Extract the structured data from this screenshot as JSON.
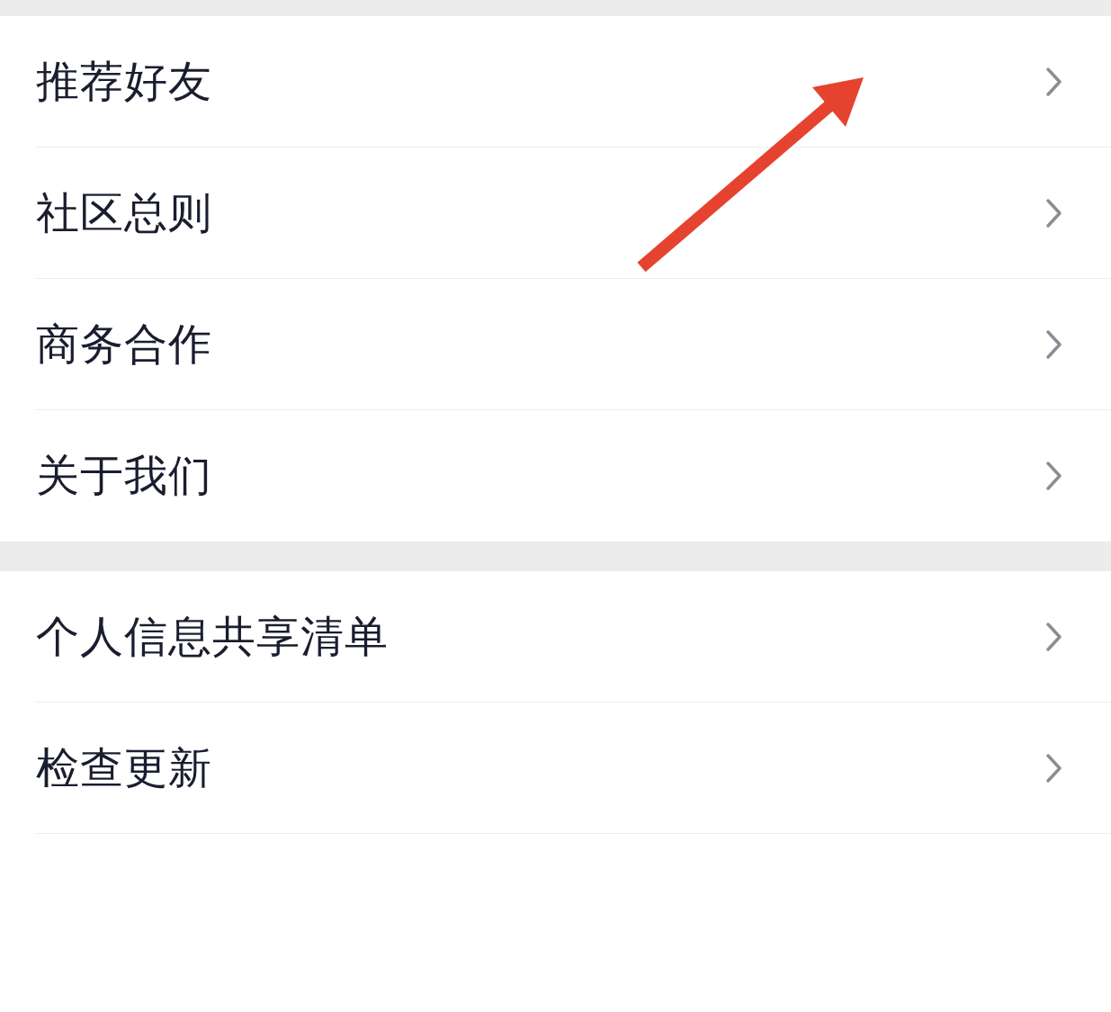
{
  "groups": [
    {
      "items": [
        {
          "label": "推荐好友"
        },
        {
          "label": "社区总则"
        },
        {
          "label": "商务合作"
        },
        {
          "label": "关于我们"
        }
      ]
    },
    {
      "items": [
        {
          "label": "个人信息共享清单"
        },
        {
          "label": "检查更新"
        }
      ]
    }
  ]
}
